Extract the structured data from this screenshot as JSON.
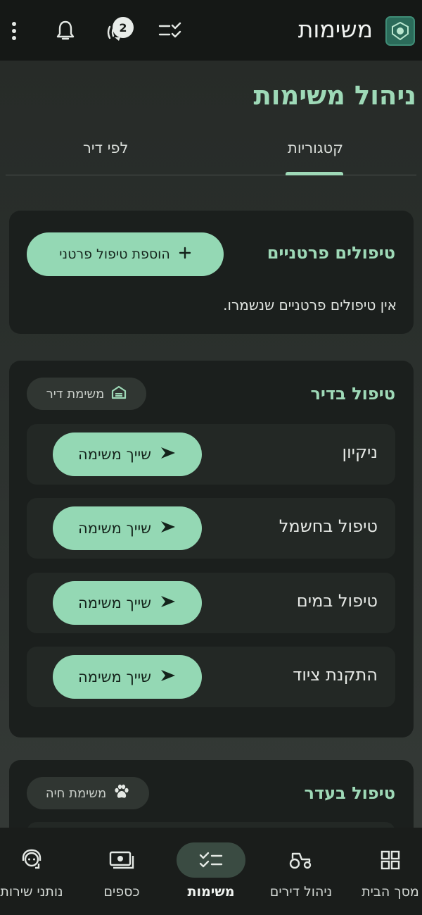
{
  "header": {
    "title": "משימות",
    "notification_count": "2"
  },
  "page": {
    "title": "ניהול משימות",
    "tabs": [
      {
        "label": "קטגוריות",
        "active": true
      },
      {
        "label": "לפי דיר",
        "active": false
      }
    ]
  },
  "personal_card": {
    "title": "טיפולים פרטניים",
    "add_button_label": "הוספת טיפול פרטני",
    "empty_text": "אין טיפולים פרטניים שנשמרו."
  },
  "pen_card": {
    "title": "טיפול בדיר",
    "chip_label": "משימת דיר",
    "assign_label": "שייך משימה",
    "tasks": [
      {
        "label": "ניקיון"
      },
      {
        "label": "טיפול בחשמל"
      },
      {
        "label": "טיפול במים"
      },
      {
        "label": "התקנת ציוד"
      }
    ]
  },
  "herd_card": {
    "title": "טיפול בעדר",
    "chip_label": "משימת חיה"
  },
  "bottom_nav": {
    "items": [
      {
        "label": "מסך הבית",
        "icon": "grid-icon",
        "active": false
      },
      {
        "label": "ניהול דירים",
        "icon": "tractor-icon",
        "active": false
      },
      {
        "label": "משימות",
        "icon": "checklist-icon",
        "active": true
      },
      {
        "label": "כספים",
        "icon": "money-icon",
        "active": false
      },
      {
        "label": "נותני שירות",
        "icon": "support-agent-icon",
        "active": false
      }
    ]
  },
  "colors": {
    "accent": "#94d8b4",
    "title_green": "#9ed9b7",
    "card_bg": "#1b1f1d",
    "topbar_bg": "#151816"
  }
}
